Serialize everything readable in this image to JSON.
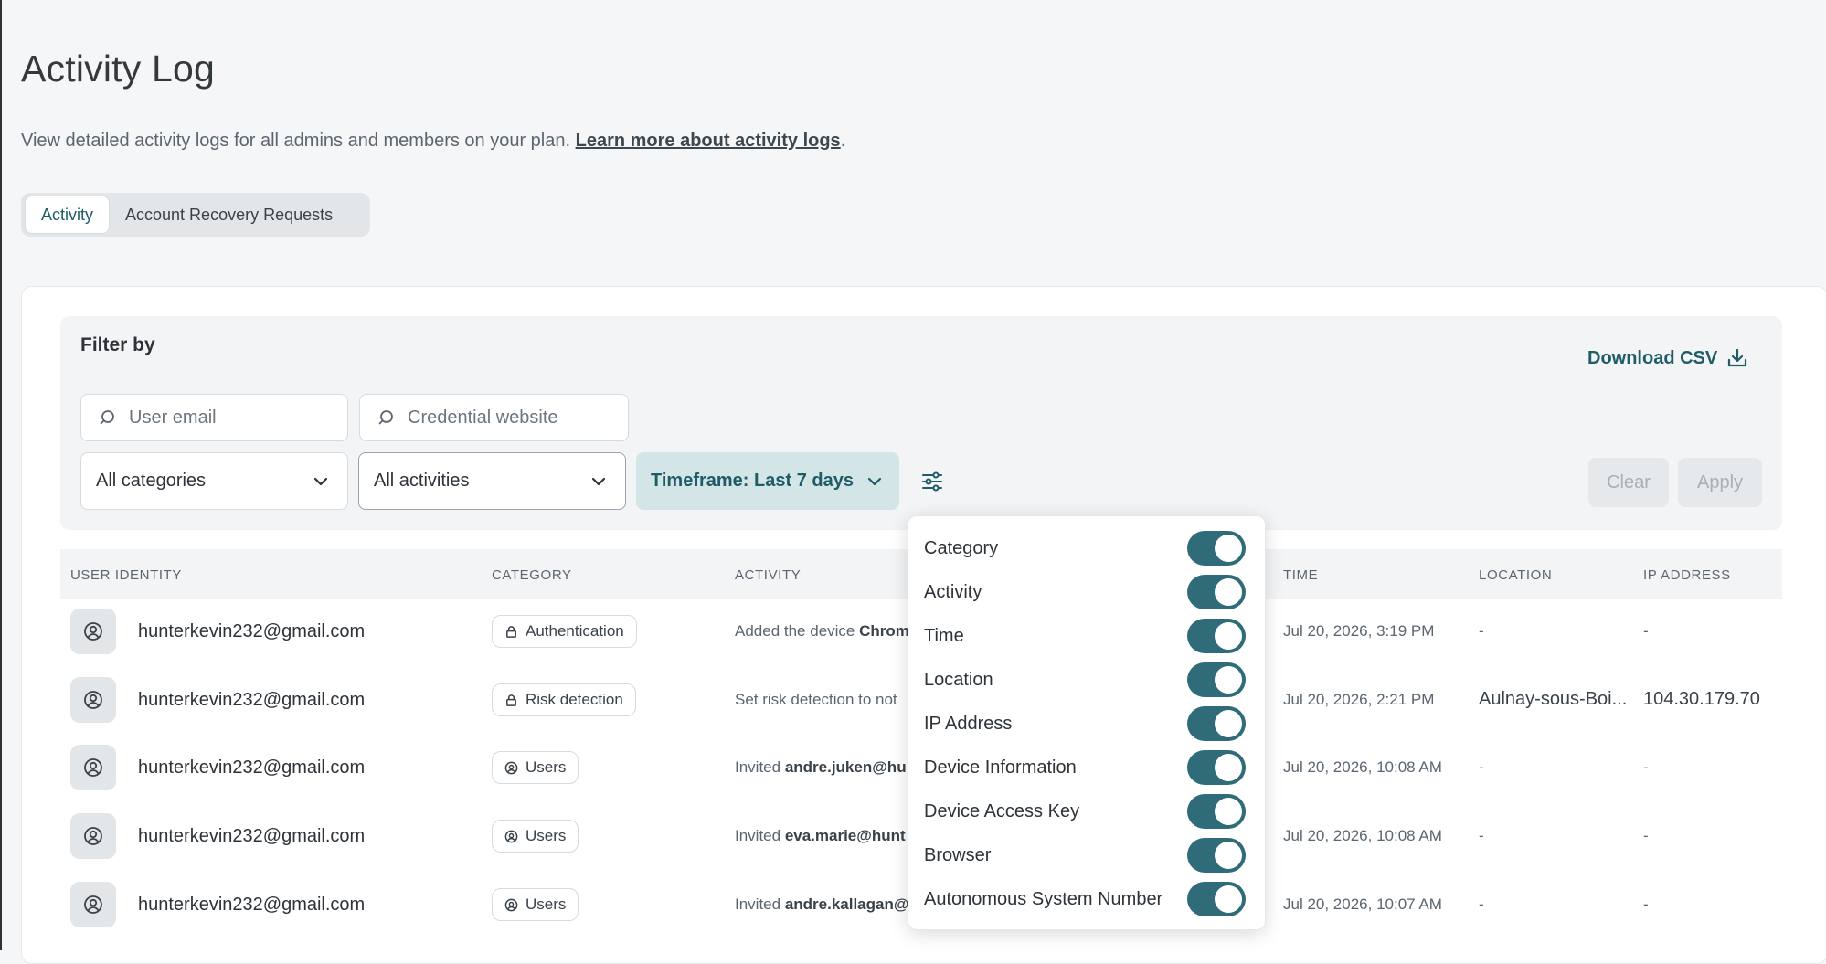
{
  "page": {
    "title": "Activity Log",
    "description": "View detailed activity logs for all admins and members on your plan. ",
    "learn_more": "Learn more about activity logs",
    "period": "."
  },
  "tabs": [
    {
      "label": "Activity",
      "active": true
    },
    {
      "label": "Account Recovery Requests",
      "active": false
    }
  ],
  "filters": {
    "title": "Filter by",
    "download_label": "Download CSV",
    "user_email_placeholder": "User email",
    "credential_placeholder": "Credential website",
    "category_select": "All categories",
    "activity_select": "All activities",
    "timeframe": "Timeframe: Last 7 days",
    "clear_label": "Clear",
    "apply_label": "Apply"
  },
  "table": {
    "headers": [
      "USER IDENTITY",
      "CATEGORY",
      "ACTIVITY",
      "TIME",
      "LOCATION",
      "IP ADDRESS"
    ],
    "rows": [
      {
        "email": "hunterkevin232@gmail.com",
        "category": "Authentication",
        "category_icon": "lock-icon",
        "activity_prefix": "Added the device ",
        "activity_bold": "Chrome",
        "time": "Jul 20, 2026, 3:19 PM",
        "location": "-",
        "ip": "-"
      },
      {
        "email": "hunterkevin232@gmail.com",
        "category": "Risk detection",
        "category_icon": "lock-icon",
        "activity_prefix": "Set risk detection to not",
        "activity_bold": "",
        "time": "Jul 20, 2026, 2:21 PM",
        "location": "Aulnay-sous-Boi...",
        "ip": "104.30.179.70"
      },
      {
        "email": "hunterkevin232@gmail.com",
        "category": "Users",
        "category_icon": "user-icon",
        "activity_prefix": "Invited ",
        "activity_bold": "andre.juken@hu",
        "time": "Jul 20, 2026, 10:08 AM",
        "location": "-",
        "ip": "-"
      },
      {
        "email": "hunterkevin232@gmail.com",
        "category": "Users",
        "category_icon": "user-icon",
        "activity_prefix": "Invited ",
        "activity_bold": "eva.marie@hunt",
        "time": "Jul 20, 2026, 10:08 AM",
        "location": "-",
        "ip": "-"
      },
      {
        "email": "hunterkevin232@gmail.com",
        "category": "Users",
        "category_icon": "user-icon",
        "activity_prefix": "Invited ",
        "activity_bold": "andre.kallagan@",
        "time": "Jul 20, 2026, 10:07 AM",
        "location": "-",
        "ip": "-"
      }
    ]
  },
  "column_popover": {
    "items": [
      {
        "label": "Category",
        "on": true
      },
      {
        "label": "Activity",
        "on": true
      },
      {
        "label": "Time",
        "on": true
      },
      {
        "label": "Location",
        "on": true
      },
      {
        "label": "IP Address",
        "on": true
      },
      {
        "label": "Device Information",
        "on": true
      },
      {
        "label": "Device Access Key",
        "on": true
      },
      {
        "label": "Browser",
        "on": true
      },
      {
        "label": "Autonomous System Number",
        "on": true
      }
    ]
  },
  "colors": {
    "accent": "#1f5c66",
    "toggle_on": "#2f6b78",
    "timeframe_bg": "#d3e5e7"
  }
}
